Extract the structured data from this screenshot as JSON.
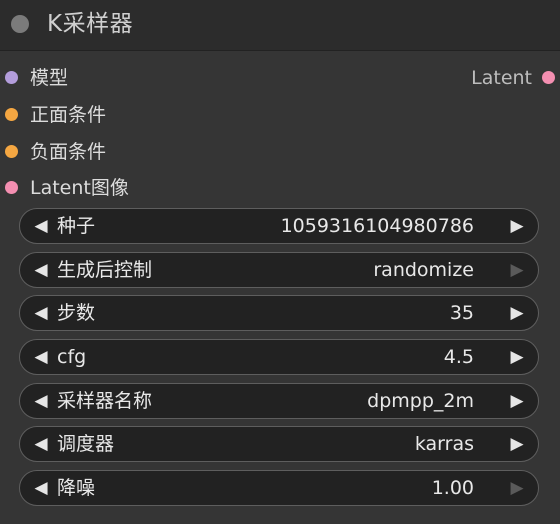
{
  "node": {
    "title": "K采样器"
  },
  "inputs": [
    {
      "label": "模型",
      "color": "#b39ddb"
    },
    {
      "label": "正面条件",
      "color": "#f5a742"
    },
    {
      "label": "负面条件",
      "color": "#f5a742"
    },
    {
      "label": "Latent图像",
      "color": "#f48fb1"
    }
  ],
  "outputs": [
    {
      "label": "Latent",
      "color": "#f48fb1"
    }
  ],
  "widgets": [
    {
      "label": "种子",
      "value": "1059316104980786",
      "right_arrow_enabled": true
    },
    {
      "label": "生成后控制",
      "value": "randomize",
      "right_arrow_enabled": false
    },
    {
      "label": "步数",
      "value": "35",
      "right_arrow_enabled": true
    },
    {
      "label": "cfg",
      "value": "4.5",
      "right_arrow_enabled": true
    },
    {
      "label": "采样器名称",
      "value": "dpmpp_2m",
      "right_arrow_enabled": true
    },
    {
      "label": "调度器",
      "value": "karras",
      "right_arrow_enabled": true
    },
    {
      "label": "降噪",
      "value": "1.00",
      "right_arrow_enabled": false
    }
  ],
  "icons": {
    "left_arrow": "◀",
    "right_arrow": "▶",
    "left_arrow_icon": "triangle-left-icon",
    "right_arrow_icon": "triangle-right-icon"
  }
}
